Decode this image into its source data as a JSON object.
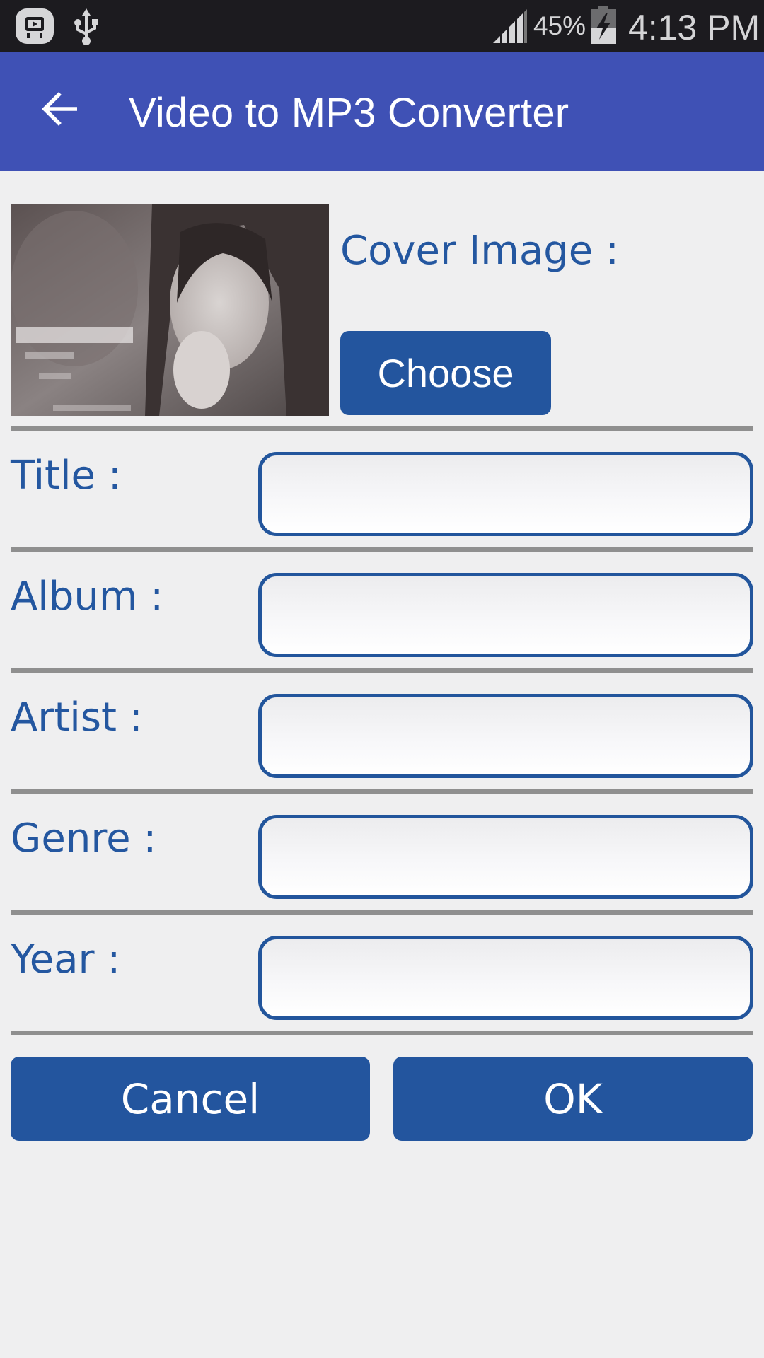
{
  "status_bar": {
    "left_icons": [
      "app-notification-icon",
      "usb-icon"
    ],
    "signal_icon": "signal-icon",
    "battery_percent": "45%",
    "battery_icon": "battery-charging-icon",
    "time": "4:13 PM"
  },
  "app_bar": {
    "back_icon": "back-arrow-icon",
    "title": "Video to MP3 Converter",
    "color": "#3F51B5"
  },
  "cover": {
    "label": "Cover Image :",
    "choose_label": "Choose",
    "image_alt": "cover-image-thumbnail"
  },
  "fields": [
    {
      "label": "Title :",
      "value": "",
      "placeholder": ""
    },
    {
      "label": "Album :",
      "value": "",
      "placeholder": ""
    },
    {
      "label": "Artist :",
      "value": "",
      "placeholder": ""
    },
    {
      "label": "Genre :",
      "value": "",
      "placeholder": ""
    },
    {
      "label": "Year :",
      "value": "",
      "placeholder": ""
    }
  ],
  "actions": {
    "cancel_label": "Cancel",
    "ok_label": "OK"
  },
  "colors": {
    "accent": "#23559E",
    "label_text": "#2457A0",
    "divider": "#8F8F8F",
    "background": "#EFEFF0"
  }
}
